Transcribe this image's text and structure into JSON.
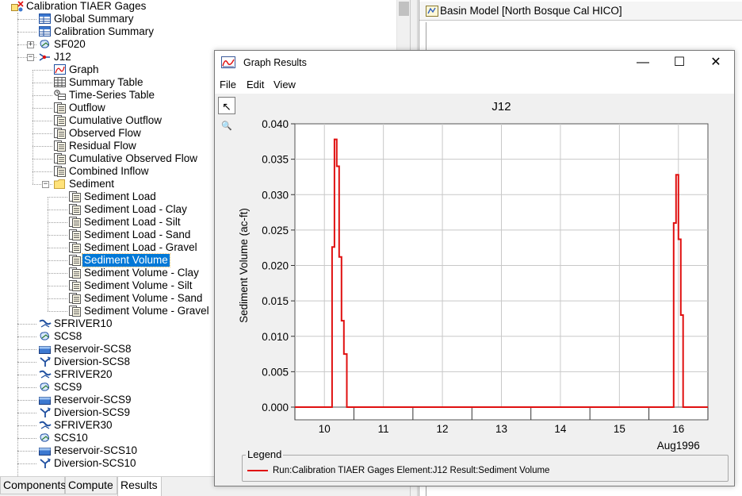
{
  "tree": {
    "root_label": "Calibration TIAER Gages",
    "items": [
      {
        "label": "Global Summary",
        "icon": "summary-table-icon"
      },
      {
        "label": "Calibration Summary",
        "icon": "summary-table-icon"
      },
      {
        "label": "SF020",
        "icon": "subbasin-icon"
      },
      {
        "label": "J12",
        "icon": "junction-icon"
      },
      {
        "label": "Graph",
        "icon": "graph-icon"
      },
      {
        "label": "Summary Table",
        "icon": "table-icon"
      },
      {
        "label": "Time-Series Table",
        "icon": "time-series-table-icon"
      },
      {
        "label": "Outflow",
        "icon": "time-series-icon"
      },
      {
        "label": "Cumulative Outflow",
        "icon": "time-series-icon"
      },
      {
        "label": "Observed Flow",
        "icon": "time-series-icon"
      },
      {
        "label": "Residual Flow",
        "icon": "time-series-icon"
      },
      {
        "label": "Cumulative Observed Flow",
        "icon": "time-series-icon"
      },
      {
        "label": "Combined Inflow",
        "icon": "time-series-icon"
      },
      {
        "label": "Sediment",
        "icon": "folder-icon"
      },
      {
        "label": "Sediment Load",
        "icon": "time-series-icon"
      },
      {
        "label": "Sediment Load - Clay",
        "icon": "time-series-icon"
      },
      {
        "label": "Sediment Load - Silt",
        "icon": "time-series-icon"
      },
      {
        "label": "Sediment Load - Sand",
        "icon": "time-series-icon"
      },
      {
        "label": "Sediment Load - Gravel",
        "icon": "time-series-icon"
      },
      {
        "label": "Sediment Volume",
        "icon": "time-series-icon"
      },
      {
        "label": "Sediment Volume - Clay",
        "icon": "time-series-icon"
      },
      {
        "label": "Sediment Volume - Silt",
        "icon": "time-series-icon"
      },
      {
        "label": "Sediment Volume - Sand",
        "icon": "time-series-icon"
      },
      {
        "label": "Sediment Volume - Gravel",
        "icon": "time-series-icon"
      },
      {
        "label": "SFRIVER10",
        "icon": "reach-icon"
      },
      {
        "label": "SCS8",
        "icon": "subbasin-icon"
      },
      {
        "label": "Reservoir-SCS8",
        "icon": "reservoir-icon"
      },
      {
        "label": "Diversion-SCS8",
        "icon": "diversion-icon"
      },
      {
        "label": "SFRIVER20",
        "icon": "reach-icon"
      },
      {
        "label": "SCS9",
        "icon": "subbasin-icon"
      },
      {
        "label": "Reservoir-SCS9",
        "icon": "reservoir-icon"
      },
      {
        "label": "Diversion-SCS9",
        "icon": "diversion-icon"
      },
      {
        "label": "SFRIVER30",
        "icon": "reach-icon"
      },
      {
        "label": "SCS10",
        "icon": "subbasin-icon"
      },
      {
        "label": "Reservoir-SCS10",
        "icon": "reservoir-icon"
      },
      {
        "label": "Diversion-SCS10",
        "icon": "diversion-icon"
      }
    ],
    "selected": "Sediment Volume"
  },
  "bottom_tabs": [
    {
      "label": "Components"
    },
    {
      "label": "Compute"
    },
    {
      "label": "Results",
      "active": true
    }
  ],
  "basin_window": {
    "title": "Basin Model [North Bosque Cal HICO]",
    "icon": "basin-model-icon"
  },
  "graph_window": {
    "title": "Graph Results",
    "icon": "graph-icon",
    "controls": {
      "minimize": "—",
      "maximize": "☐",
      "close": "✕"
    },
    "menu": [
      "File",
      "Edit",
      "View"
    ],
    "tools": [
      {
        "name": "pointer-tool",
        "glyph": "↖",
        "active": true
      },
      {
        "name": "zoom-tool",
        "glyph": "🔍",
        "active": false
      }
    ],
    "legend": {
      "title": "Legend",
      "entry": "Run:Calibration TIAER Gages Element:J12 Result:Sediment Volume"
    }
  },
  "colors": {
    "series": "#e01010",
    "selection": "#0078d7",
    "grid": "#c8c8c8"
  },
  "chart_data": {
    "type": "line",
    "title": "J12",
    "xlabel": "",
    "ylabel": "Sediment Volume (ac-ft)",
    "x_tick_labels": [
      "10",
      "11",
      "12",
      "13",
      "14",
      "15",
      "16"
    ],
    "x_secondary_label": "Aug1996",
    "xlim": [
      9.5,
      16.5
    ],
    "ylim": [
      0,
      0.04
    ],
    "y_ticks": [
      "0.000",
      "0.005",
      "0.010",
      "0.015",
      "0.020",
      "0.025",
      "0.030",
      "0.035",
      "0.040"
    ],
    "grid": true,
    "legend_position": "bottom",
    "step": true,
    "series": [
      {
        "name": "Run:Calibration TIAER Gages Element:J12 Result:Sediment Volume",
        "x": [
          9.5,
          10.13,
          10.13,
          10.17,
          10.17,
          10.21,
          10.21,
          10.25,
          10.25,
          10.29,
          10.29,
          10.33,
          10.33,
          10.38,
          10.38,
          15.92,
          15.92,
          15.96,
          15.96,
          16.0,
          16.0,
          16.04,
          16.04,
          16.08,
          16.08,
          16.5
        ],
        "y": [
          0,
          0,
          0.0226,
          0.0226,
          0.0378,
          0.0378,
          0.034,
          0.034,
          0.0212,
          0.0212,
          0.0122,
          0.0122,
          0.0075,
          0.0075,
          0,
          0,
          0.026,
          0.026,
          0.0328,
          0.0328,
          0.0237,
          0.0237,
          0.013,
          0.013,
          0,
          0
        ]
      }
    ]
  }
}
